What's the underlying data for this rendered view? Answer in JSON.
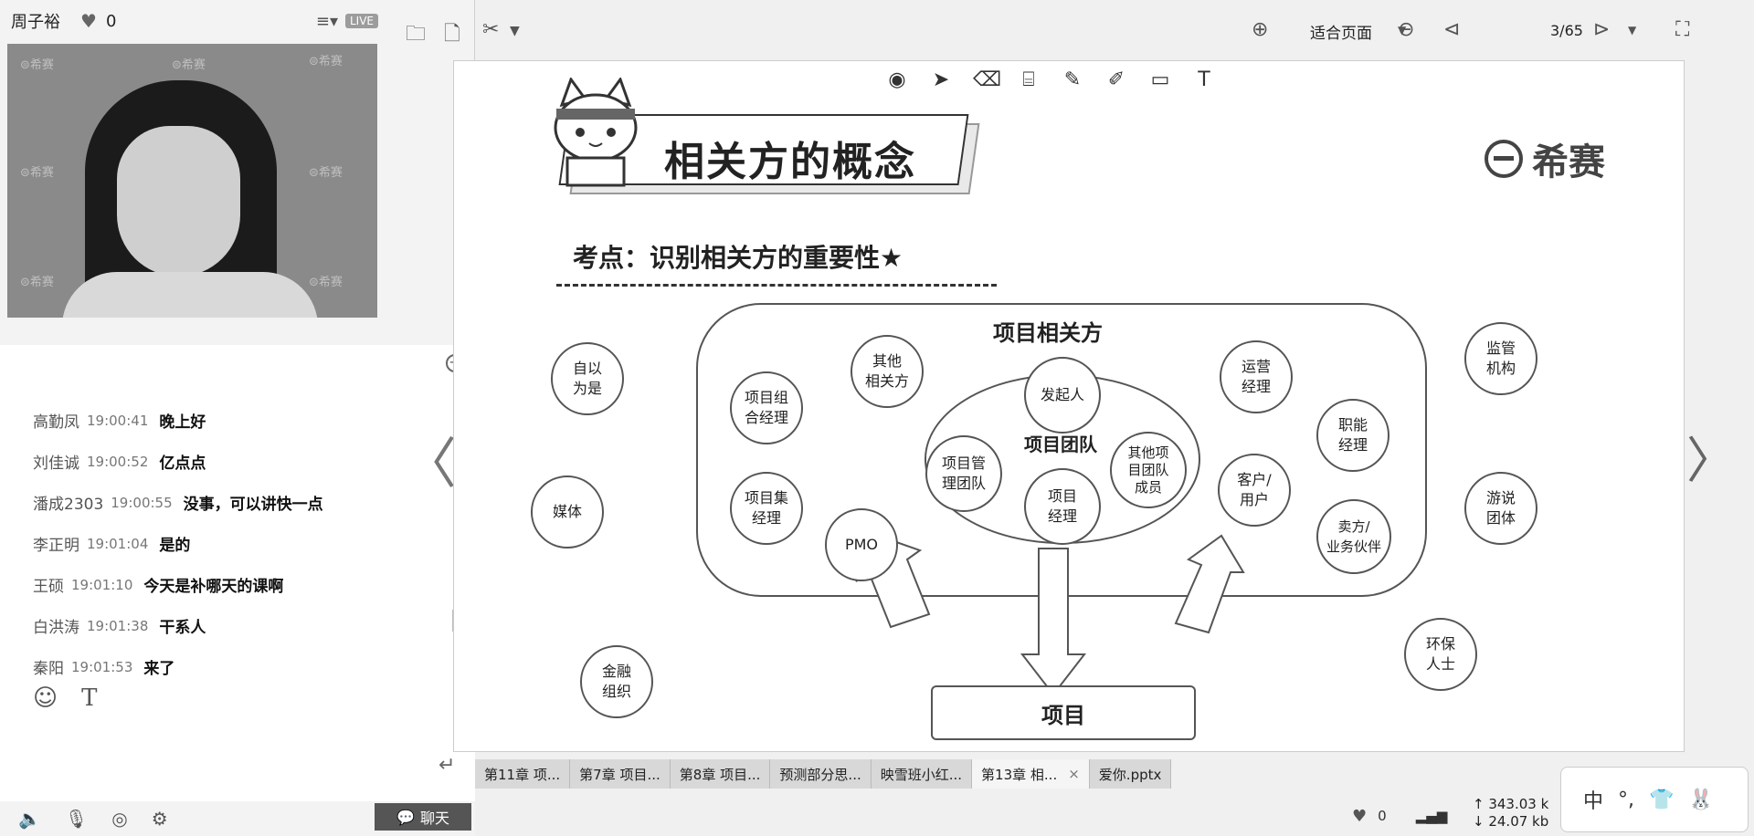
{
  "host": {
    "name": "周子裕",
    "likes": "0",
    "live_badge": "LIVE"
  },
  "video": {
    "watermark": "⊜希赛"
  },
  "chat": {
    "messages": [
      {
        "user": "高勤凤",
        "time": "19:00:41",
        "text": "晚上好"
      },
      {
        "user": "刘佳诚",
        "time": "19:00:52",
        "text": "亿点点"
      },
      {
        "user": "潘成2303",
        "time": "19:00:55",
        "text": "没事，可以讲快一点"
      },
      {
        "user": "李正明",
        "time": "19:01:04",
        "text": "是的"
      },
      {
        "user": "王硕",
        "time": "19:01:10",
        "text": "今天是补哪天的课啊"
      },
      {
        "user": "白洪涛",
        "time": "19:01:38",
        "text": "干系人"
      },
      {
        "user": "秦阳",
        "time": "19:01:53",
        "text": "来了"
      }
    ],
    "tab_label": "聊天"
  },
  "toolbar": {
    "zoom_mode": "适合页面",
    "page_indicator": "3/65"
  },
  "slide": {
    "title": "相关方的概念",
    "brand": "希赛",
    "exam_point": "考点：识别相关方的重要性★",
    "stakeholders_label": "项目相关方",
    "team_label": "项目团队",
    "project_label": "项目",
    "bubbles": {
      "self_righteous": "自以\n为是",
      "media": "媒体",
      "finance": "金融\n组织",
      "portfolio_mgr": "项目组\n合经理",
      "program_mgr": "项目集\n经理",
      "other": "其他\n相关方",
      "pmo": "PMO",
      "sponsor": "发起人",
      "pm_team": "项目管\n理团队",
      "pm": "项目\n经理",
      "other_team": "其他项\n目团队\n成员",
      "ops_mgr": "运营\n经理",
      "func_mgr": "职能\n经理",
      "customer": "客户/\n用户",
      "seller": "卖方/\n业务伙伴",
      "regulator": "监管\n机构",
      "lobby": "游说\n团体",
      "env": "环保\n人士"
    }
  },
  "file_tabs": [
    {
      "label": "第11章 项..."
    },
    {
      "label": "第7章 项目..."
    },
    {
      "label": "第8章 项目..."
    },
    {
      "label": "预测部分思..."
    },
    {
      "label": "映雪班小红..."
    },
    {
      "label": "第13章 相...",
      "active": true,
      "close": "×"
    },
    {
      "label": "爱你.pptx"
    }
  ],
  "status": {
    "likes": "0",
    "upload": "343.03 k",
    "download": "24.07 kb"
  },
  "ime": {
    "mode": "中",
    "punct": "°,"
  }
}
